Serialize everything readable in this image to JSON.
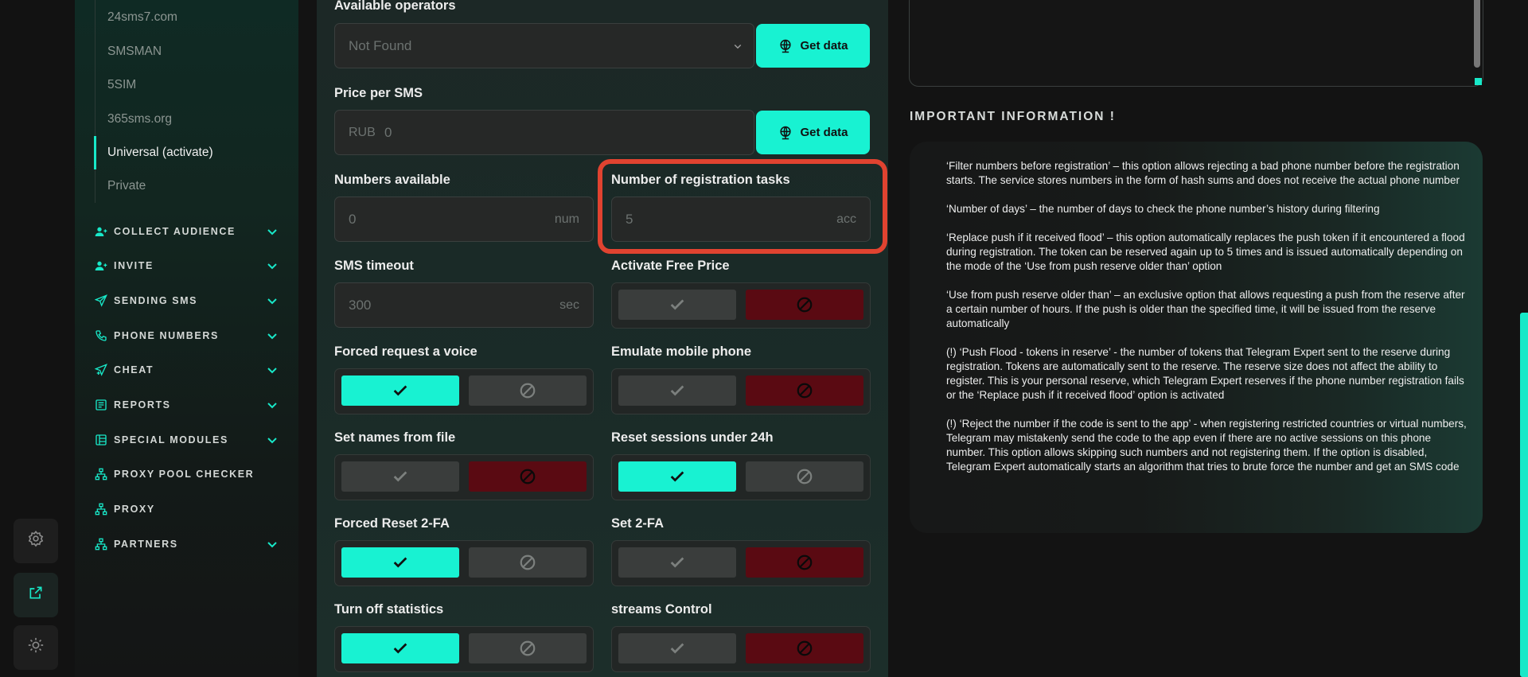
{
  "rail": {
    "buttons": [
      {
        "icon": "gear-icon"
      },
      {
        "icon": "external-link-icon"
      },
      {
        "icon": "sun-icon"
      }
    ]
  },
  "sidebar": {
    "sub_items": [
      "24sms7.com",
      "SMSMAN",
      "5SIM",
      "365sms.org",
      "Universal (activate)",
      "Private"
    ],
    "active_sub_item": "Universal (activate)",
    "nav": [
      {
        "label": "COLLECT AUDIENCE",
        "icon": "users-icon",
        "expandable": true
      },
      {
        "label": "INVITE",
        "icon": "user-plus-icon",
        "expandable": true
      },
      {
        "label": "SENDING SMS",
        "icon": "paper-plane-icon",
        "expandable": true
      },
      {
        "label": "PHONE NUMBERS",
        "icon": "phone-icon",
        "expandable": true
      },
      {
        "label": "CHEAT",
        "icon": "send-plus-icon",
        "expandable": true
      },
      {
        "label": "REPORTS",
        "icon": "report-icon",
        "expandable": true
      },
      {
        "label": "SPECIAL MODULES",
        "icon": "modules-icon",
        "expandable": true
      },
      {
        "label": "PROXY POOL CHECKER",
        "icon": "network-icon",
        "expandable": false
      },
      {
        "label": "PROXY",
        "icon": "network-icon",
        "expandable": false
      },
      {
        "label": "PARTNERS",
        "icon": "network-icon",
        "expandable": true
      }
    ],
    "accent": "#18e8c8"
  },
  "main": {
    "available_operators": {
      "label": "Available operators",
      "value": "Not Found",
      "button": "Get data"
    },
    "price_per_sms": {
      "label": "Price per SMS",
      "prefix": "RUB",
      "value": "0",
      "button": "Get data"
    },
    "numbers_available": {
      "label": "Numbers available",
      "value": "0",
      "unit": "num"
    },
    "registration_tasks": {
      "label": "Number of registration tasks",
      "value": "5",
      "unit": "acc"
    },
    "sms_timeout": {
      "label": "SMS timeout",
      "value": "300",
      "unit": "sec"
    },
    "toggles": [
      {
        "label": "Activate Free Price",
        "state": "off"
      },
      {
        "label": "Forced request a voice",
        "state": "on"
      },
      {
        "label": "Emulate mobile phone",
        "state": "off"
      },
      {
        "label": "Set names from file",
        "state": "off"
      },
      {
        "label": "Reset sessions under 24h",
        "state": "on"
      },
      {
        "label": "Forced Reset 2-FA",
        "state": "on"
      },
      {
        "label": "Set 2-FA",
        "state": "off"
      },
      {
        "label": "Turn off statistics",
        "state": "on"
      },
      {
        "label": "streams Control",
        "state": "off"
      }
    ],
    "colors": {
      "on": "#18f2d2",
      "blocked": "#5a0a12",
      "highlight": "#e04330"
    }
  },
  "info": {
    "title": "IMPORTANT INFORMATION !",
    "paragraphs": [
      "‘Filter numbers before registration’ – this option allows rejecting a bad phone number before the registration starts. The service stores numbers in the form of hash sums and does not receive the actual phone number",
      "‘Number of days’ – the number of days to check the phone number’s history during filtering",
      "‘Replace push if it received flood’ – this option automatically replaces the push token if it encountered a flood during registration. The token can be reserved again up to 5 times and is issued automatically depending on the mode of the ‘Use from push reserve older than’ option",
      "‘Use from push reserve older than’ – an exclusive option that allows requesting a push from the reserve after a certain number of hours. If the push is older than the specified time, it will be issued from the reserve automatically",
      "(!) ‘Push Flood - tokens in reserve’ - the number of tokens that Telegram Expert sent to the reserve during registration. Tokens are automatically sent to the reserve. The reserve size does not affect the ability to register. This is your personal reserve, which Telegram Expert reserves if the phone number registration fails or the ‘Replace push if it received flood’ option is activated",
      "(!) ‘Reject the number if the code is sent to the app’ - when registering restricted countries or virtual numbers, Telegram may mistakenly send the code to the app even if there are no active sessions on this phone number. This option allows skipping such numbers and not registering them. If the option is disabled, Telegram Expert automatically starts an algorithm that tries to brute force the number and get an SMS code"
    ]
  }
}
